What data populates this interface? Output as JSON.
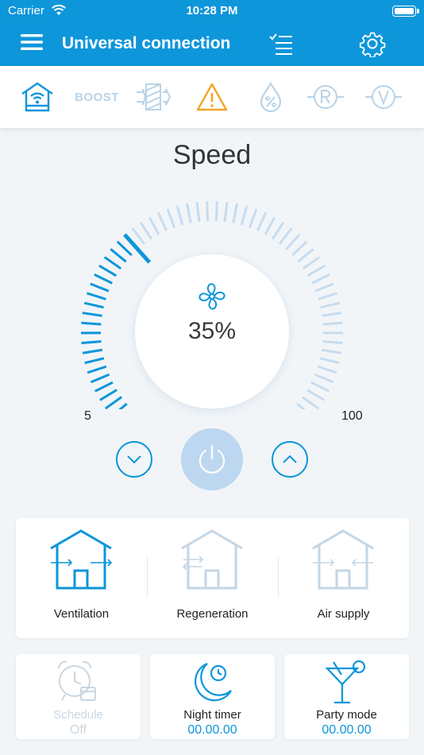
{
  "status_bar": {
    "carrier": "Carrier",
    "time": "10:28 PM",
    "battery_level": 1.0
  },
  "header": {
    "title": "Universal connection",
    "icons": [
      "menu-icon",
      "checklist-icon",
      "settings-icon"
    ]
  },
  "mode_bar": {
    "boost_label": "BOOST",
    "icons": [
      "home-wifi-icon",
      "boost-icon",
      "heat-exchanger-icon",
      "warning-icon",
      "humidity-icon",
      "r-circle-icon",
      "v-circle-icon"
    ]
  },
  "speed": {
    "title": "Speed",
    "value": "35%",
    "level": 0.35,
    "min_label": "5",
    "max_label": "100"
  },
  "controls": {
    "icons": [
      "chevron-down-icon",
      "power-icon",
      "chevron-up-icon"
    ]
  },
  "modes": [
    {
      "label": "Ventilation",
      "active": true
    },
    {
      "label": "Regeneration",
      "active": false
    },
    {
      "label": "Air supply",
      "active": false
    }
  ],
  "tiles": [
    {
      "label": "Schedule",
      "value": "Off",
      "enabled": false,
      "icon": "alarm-clock-icon"
    },
    {
      "label": "Night timer",
      "value": "00.00.00",
      "enabled": true,
      "icon": "moon-clock-icon"
    },
    {
      "label": "Party mode",
      "value": "00.00.00",
      "enabled": true,
      "icon": "cocktail-icon"
    }
  ],
  "colors": {
    "accent": "#0d96da",
    "inactive": "#b8d3e8",
    "warning": "#f2a623",
    "gauge_inactive": "#c6dcef"
  }
}
